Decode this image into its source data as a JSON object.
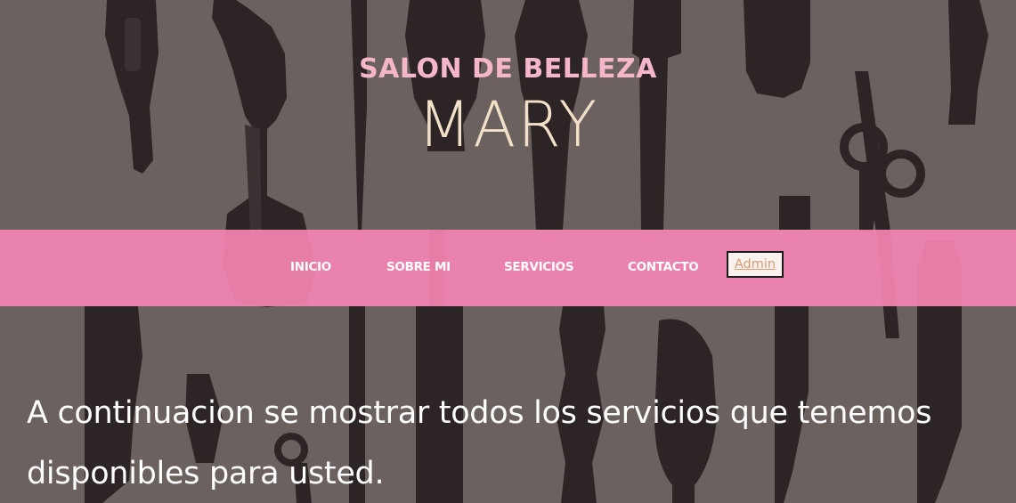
{
  "brand": {
    "line1": "SALON DE BELLEZA",
    "line2": "MARY"
  },
  "nav": {
    "items": [
      {
        "label": "INICIO"
      },
      {
        "label": "SOBRE MI"
      },
      {
        "label": "SERVICIOS"
      },
      {
        "label": "CONTACTO"
      }
    ],
    "admin_label": "Admin"
  },
  "main": {
    "intro_text": "A continuacion se mostrar todos los servicios que tenemos disponibles para usted."
  },
  "colors": {
    "background": "#6b6260",
    "silhouette": "#2c2425",
    "navbar": "#f384b2",
    "brand_pink": "#f5b6c9",
    "brand_cream": "#f3e0c8",
    "admin_text": "#d89a70"
  },
  "background_image": {
    "icons": [
      "blow-dryer-icon",
      "spray-bottle-icon",
      "tail-comb-icon",
      "paddle-brush-icon",
      "round-brush-icon",
      "comb-icon",
      "scissors-icon",
      "hair-clipper-icon"
    ]
  }
}
